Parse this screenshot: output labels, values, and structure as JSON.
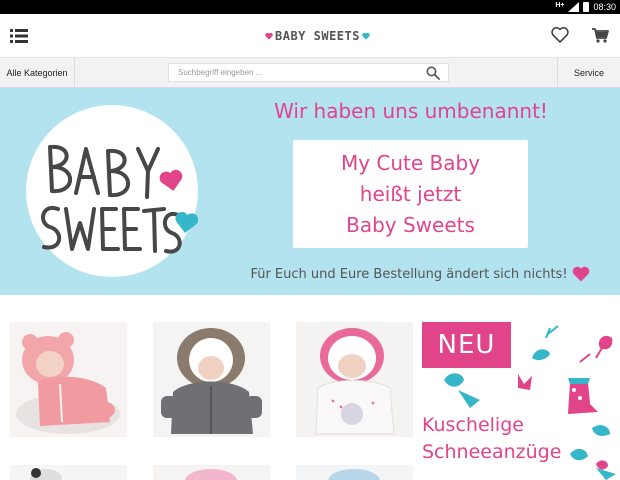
{
  "statusbar": {
    "network": "H+",
    "time": "08:30"
  },
  "header": {
    "menu_icon": "list-menu-icon",
    "logo_text": "BABY SWEETS",
    "wishlist_icon": "heart-outline-icon",
    "cart_icon": "shopping-cart-icon"
  },
  "navbar": {
    "categories_label": "Alle Kategorien",
    "search_placeholder": "Suchbegriff eingeben ...",
    "service_label": "Service"
  },
  "banner": {
    "headline": "Wir haben uns umbenannt!",
    "box_lines": [
      "My Cute Baby",
      "heißt jetzt",
      "Baby Sweets"
    ],
    "footer": "Für Euch und Eure Bestellung ändert sich nichts!",
    "logo_text": "BABY SWEETS",
    "accent_pink": "#e2448a",
    "accent_teal": "#35b6c9",
    "background": "#b3e3ee"
  },
  "products": [
    {
      "name": "Baby-Overall rosa mit Kapuze",
      "color": "#f2a0a5"
    },
    {
      "name": "Baby-Overall grau mit Fellkapuze",
      "color": "#7d7d82"
    },
    {
      "name": "Baby-Schneeanzug weiß mit Sternen",
      "color": "#f0ecec"
    }
  ],
  "promo": {
    "badge": "NEU",
    "lines": [
      "Kuschelige",
      "Schneeanzüge"
    ]
  }
}
